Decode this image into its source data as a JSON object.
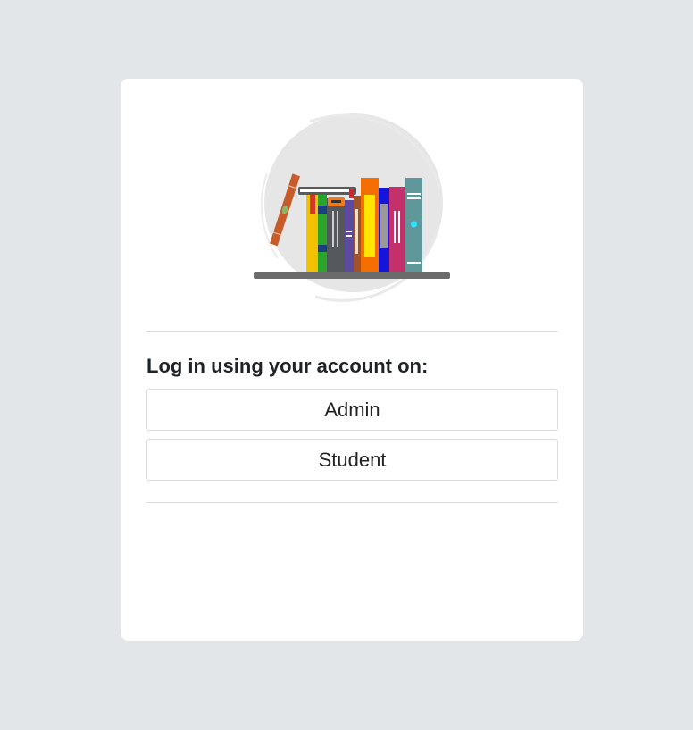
{
  "login": {
    "heading": "Log in using your account on:",
    "buttons": [
      {
        "label": "Admin"
      },
      {
        "label": "Student"
      }
    ]
  },
  "colors": {
    "page_background": "#e3e6e9",
    "card_background": "#ffffff",
    "divider": "#dcdcdc"
  },
  "logo": {
    "icon": "bookshelf-icon"
  }
}
